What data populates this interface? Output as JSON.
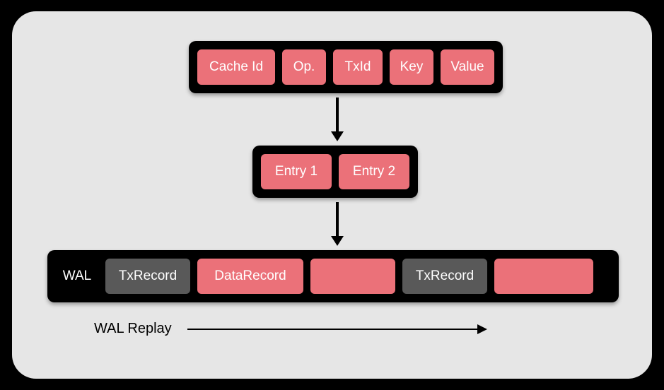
{
  "entry_fields": {
    "cache_id": "Cache Id",
    "op": "Op.",
    "txid": "TxId",
    "key": "Key",
    "value": "Value"
  },
  "entries": {
    "e1": "Entry 1",
    "e2": "Entry 2"
  },
  "wal": {
    "label": "WAL",
    "records": {
      "r1": "TxRecord",
      "r2": "DataRecord",
      "r3": "",
      "r4": "TxRecord",
      "r5": ""
    }
  },
  "replay_label": "WAL Replay"
}
